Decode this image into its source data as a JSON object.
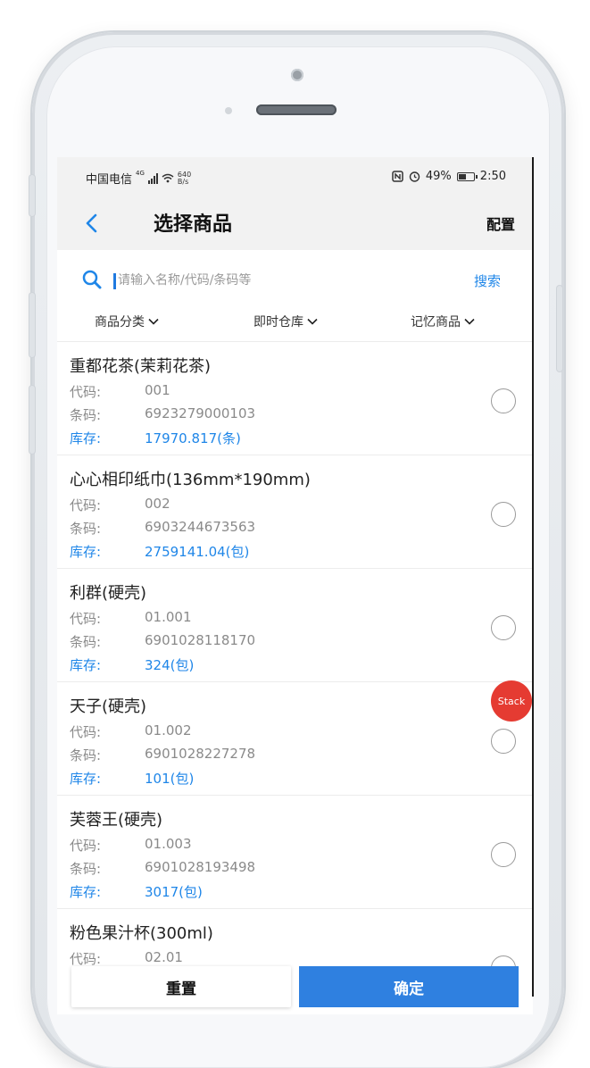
{
  "status_bar": {
    "carrier": "中国电信",
    "network_type": "4G",
    "net_speed_value": "640",
    "net_speed_unit": "B/s",
    "battery": "49%",
    "time": "2:50"
  },
  "nav": {
    "title": "选择商品",
    "config_label": "配置"
  },
  "search": {
    "placeholder": "请输入名称/代码/条码等",
    "value": "",
    "button_label": "搜索"
  },
  "filters": [
    {
      "label": "商品分类"
    },
    {
      "label": "即时仓库"
    },
    {
      "label": "记忆商品"
    }
  ],
  "labels": {
    "code": "代码:",
    "barcode": "条码:",
    "stock": "库存:"
  },
  "items": [
    {
      "name": "重都花茶(茉莉花茶)",
      "code": "001",
      "barcode": "6923279000103",
      "stock": "17970.817(条)",
      "selected": false
    },
    {
      "name": "心心相印纸巾(136mm*190mm)",
      "code": "002",
      "barcode": "6903244673563",
      "stock": "2759141.04(包)",
      "selected": false
    },
    {
      "name": "利群(硬壳)",
      "code": "01.001",
      "barcode": "6901028118170",
      "stock": "324(包)",
      "selected": false
    },
    {
      "name": "天子(硬壳)",
      "code": "01.002",
      "barcode": "6901028227278",
      "stock": "101(包)",
      "selected": false
    },
    {
      "name": "芙蓉王(硬壳)",
      "code": "01.003",
      "barcode": "6901028193498",
      "stock": "3017(包)",
      "selected": false
    },
    {
      "name": "粉色果汁杯(300ml)",
      "code": "02.01",
      "barcode": "",
      "stock": "",
      "selected": false
    }
  ],
  "floating_badge": "Stack",
  "buttons": {
    "reset": "重置",
    "confirm": "确定"
  },
  "colors": {
    "accent": "#1f86e8",
    "confirm_bg": "#2f80e0",
    "badge_bg": "#e53b32",
    "header_bg": "#f2f2f2"
  }
}
